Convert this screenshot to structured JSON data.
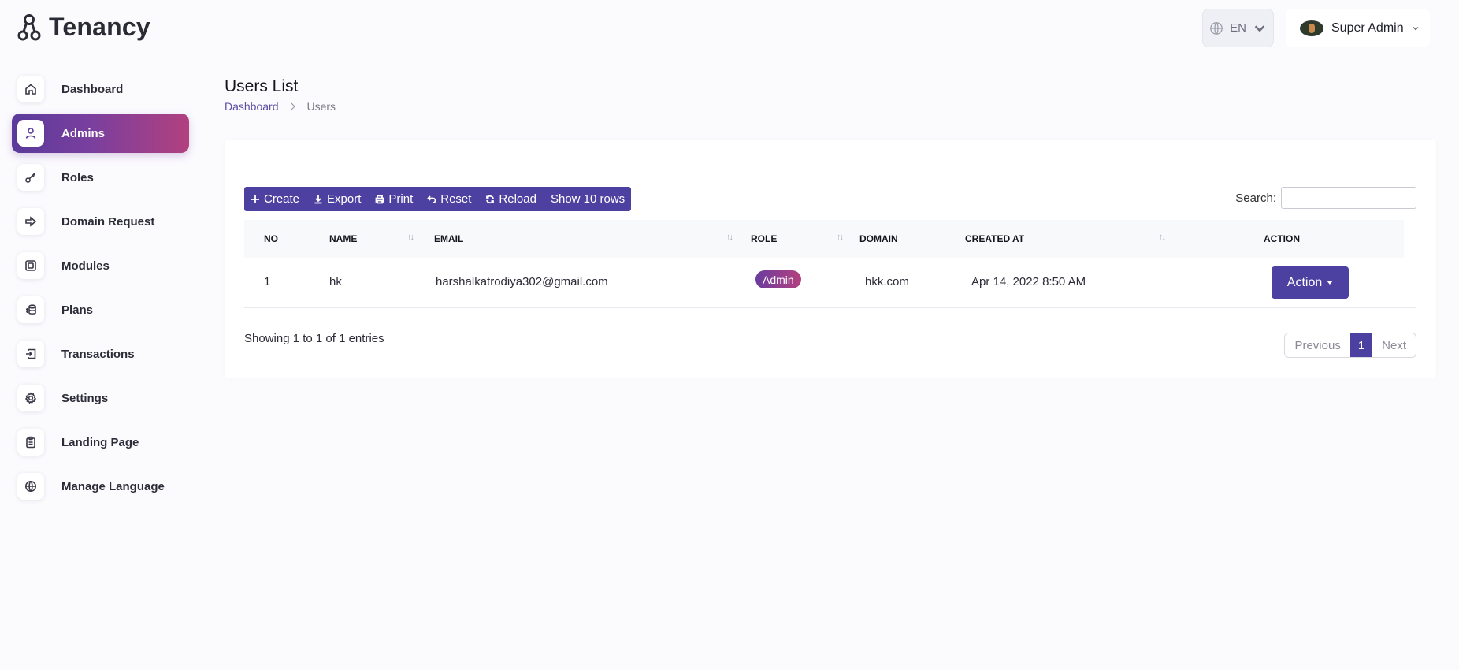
{
  "app": {
    "name": "Tenancy"
  },
  "header": {
    "language": "EN",
    "user_name": "Super Admin"
  },
  "sidebar": {
    "items": [
      {
        "label": "Dashboard",
        "icon": "home-icon",
        "active": false
      },
      {
        "label": "Admins",
        "icon": "user-icon",
        "active": true
      },
      {
        "label": "Roles",
        "icon": "key-icon",
        "active": false
      },
      {
        "label": "Domain Request",
        "icon": "arrow-right-icon",
        "active": false
      },
      {
        "label": "Modules",
        "icon": "module-icon",
        "active": false
      },
      {
        "label": "Plans",
        "icon": "coins-icon",
        "active": false
      },
      {
        "label": "Transactions",
        "icon": "transaction-icon",
        "active": false
      },
      {
        "label": "Settings",
        "icon": "gear-icon",
        "active": false
      },
      {
        "label": "Landing Page",
        "icon": "clipboard-icon",
        "active": false
      },
      {
        "label": "Manage Language",
        "icon": "globe-icon",
        "active": false
      }
    ]
  },
  "page": {
    "title": "Users List",
    "breadcrumb": {
      "home": "Dashboard",
      "current": "Users"
    }
  },
  "toolbar": {
    "create": "Create",
    "export": "Export",
    "print": "Print",
    "reset": "Reset",
    "reload": "Reload",
    "show_rows": "Show 10 rows"
  },
  "search": {
    "label": "Search:",
    "value": ""
  },
  "table": {
    "columns": [
      "NO",
      "NAME",
      "EMAIL",
      "ROLE",
      "DOMAIN",
      "CREATED AT",
      "ACTION"
    ],
    "rows": [
      {
        "no": "1",
        "name": "hk",
        "email": "harshalkatrodiya302@gmail.com",
        "role": "Admin",
        "domain": "hkk.com",
        "created_at": "Apr 14, 2022 8:50 AM",
        "action": "Action"
      }
    ]
  },
  "footer": {
    "info": "Showing 1 to 1 of 1 entries",
    "prev": "Previous",
    "page": "1",
    "next": "Next"
  },
  "colors": {
    "primary": "#4c41a0",
    "accent_gradient_start": "#5b3b9c",
    "accent_gradient_end": "#b2407f",
    "background": "#fbfbfe"
  }
}
